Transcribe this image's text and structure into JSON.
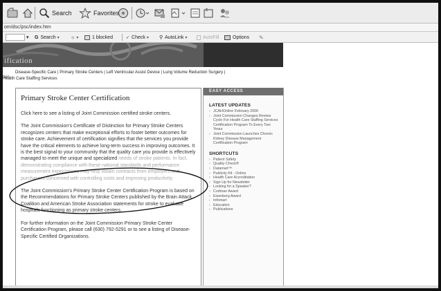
{
  "toolbar": {
    "search_label": "Search",
    "favorites_label": "Favorites"
  },
  "address": {
    "url": "om/dsc/psc/index.htm"
  },
  "toolbar2": {
    "search_label": "Search",
    "blocked_label": "1 blocked",
    "check_label": "Check",
    "autolink_label": "AutoLink",
    "autofill_label": "AutoFill",
    "options_label": "Options"
  },
  "banner": {
    "title": "ification"
  },
  "breadcrumb": {
    "prefix": "tion",
    "line1": "Disease-Specific Care | Primary Stroke Centers | Left Ventricular Assist Device | Lung Volume Reduction Surgery |",
    "line2": "Health Care Staffing Services"
  },
  "main": {
    "title": "Primary Stroke Center Certification",
    "p1": "Click here to see a listing of Joint Commission certified stroke centers.",
    "p2a": "The Joint Commission's Certificate of Distinction for Primary Stroke Centers recognizes centers that make exceptional efforts to foster better outcomes for stroke care.  Achievement of certification signifies that the services you provide have the critical elements to achieve long-term success in improving outcomes.  It is the best signal to your community that the quality care you provide is effectively managed to meet the unique and specialized",
    "p2b": "needs of stroke patients.  In fact, demonstrating compliance with these national standards and performance measurement expectations may help obtain contracts from employers and purchasers concerned with controlling costs and improving productivity.",
    "p3": "The Joint Commission's Primary Stroke Center Certification Program is based on the Recommendations for Primary Stroke Centers published by the Brain Attack Coalition and American Stroke Association statements for stroke to evaluate hospitals functioning as primary stroke centers.",
    "p4a": "For further information on the Joint Commission Primary Stroke Center Certification Program, please call (630) 792-5291 or to see a listing of ",
    "p4_link": "Disease-Specific Certified Organizations",
    "p4b": "."
  },
  "sidebar": {
    "easy_access": "EASY ACCESS",
    "latest_updates_heading": "LATEST UPDATES",
    "latest_updates": [
      "JCAHOnline February 2006",
      "Joint Commission Changes Review Cycle For Health Care Staffing Services Certification Program To Every Two Years",
      "Joint Commission Launches Chronic Kidney Disease Management Certification Program"
    ],
    "shortcuts_heading": "SHORTCUTS",
    "shortcuts": [
      "Patient Safety",
      "Quality Check®",
      "Datamart™",
      "Publicity Kit - Online",
      "Health Care Accreditation",
      "Sign Up for Newsletter",
      "Looking for a Speaker?",
      "Codman Award",
      "Eisenberg Award",
      "Infomart",
      "Education",
      "Publications"
    ]
  }
}
